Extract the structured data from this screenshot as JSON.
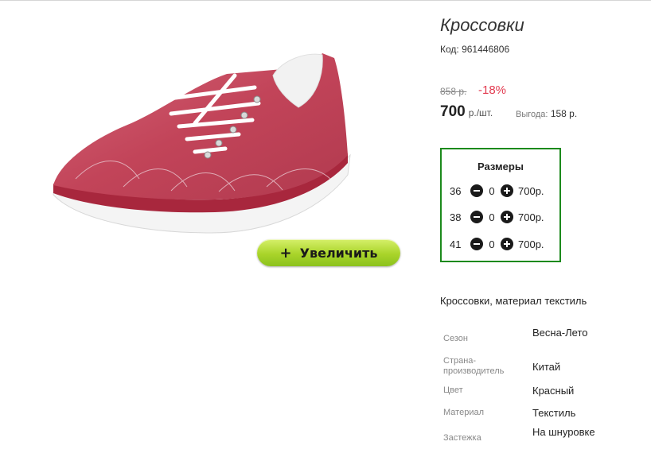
{
  "product": {
    "title": "Кроссовки",
    "code": "Код: 961446806",
    "old_price": "858 р.",
    "discount": "-18%",
    "price": "700",
    "unit": "р./шт.",
    "savings_label": "Выгода:",
    "savings_value": "158 р.",
    "description": "Кроссовки, материал текстиль",
    "image_icon": "sneaker-image"
  },
  "zoom": {
    "label": "Увеличить"
  },
  "sizes": {
    "title": "Размеры",
    "rows": [
      {
        "size": "36",
        "qty": "0",
        "price": "700р."
      },
      {
        "size": "38",
        "qty": "0",
        "price": "700р."
      },
      {
        "size": "41",
        "qty": "0",
        "price": "700р."
      }
    ]
  },
  "attributes": [
    {
      "label": "Сезон",
      "value": "Весна-Лето"
    },
    {
      "label": "Страна-производитель",
      "value": "Китай"
    },
    {
      "label": "Цвет",
      "value": "Красный"
    },
    {
      "label": "Материал",
      "value": "Текстиль"
    },
    {
      "label": "Застежка",
      "value": "На шнуровке"
    }
  ],
  "colors": {
    "accent_discount": "#e23a4f",
    "sizes_border": "#1c8a1c",
    "zoom_button": "#a9d42a",
    "shoe": "#c8485e"
  }
}
